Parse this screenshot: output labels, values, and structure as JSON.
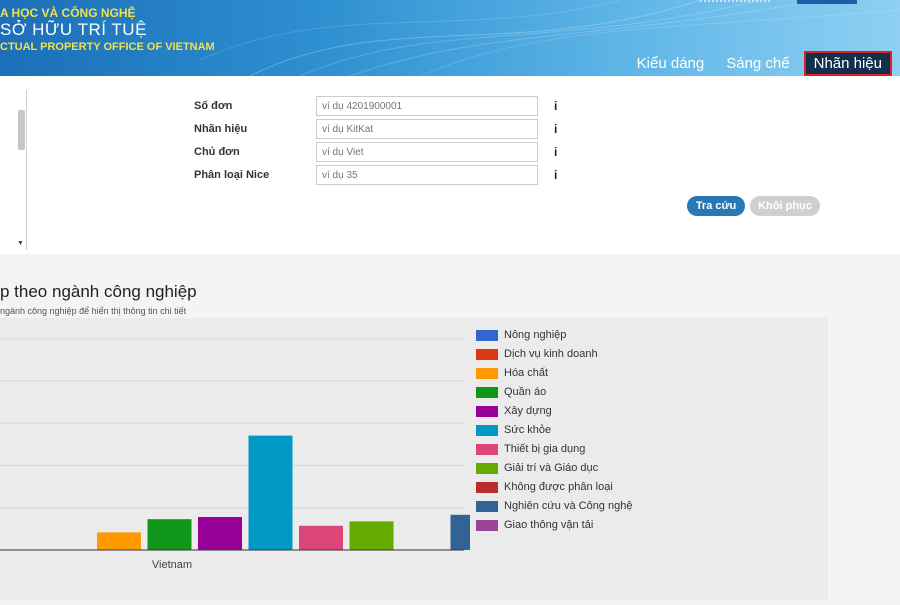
{
  "header": {
    "brand_line1": "A HỌC VÀ CÔNG NGHỆ",
    "brand_line2": "SỞ HỮU TRÍ TUỆ",
    "brand_line3": "CTUAL PROPERTY OFFICE OF VIETNAM",
    "nav": [
      {
        "label": "Kiểu dáng"
      },
      {
        "label": "Sáng chế"
      },
      {
        "label": "Nhãn hiệu",
        "active": true
      }
    ]
  },
  "search_form": {
    "fields": [
      {
        "label": "Số đơn",
        "placeholder": "ví dụ 4201900001"
      },
      {
        "label": "Nhãn hiệu",
        "placeholder": "ví dụ KitKat"
      },
      {
        "label": "Chủ đơn",
        "placeholder": "ví dụ Viet"
      },
      {
        "label": "Phân loại Nice",
        "placeholder": "ví dụ 35"
      }
    ],
    "info_icon": "i",
    "search_button": "Tra cứu",
    "reset_button": "Khôi phục"
  },
  "section": {
    "title": "p theo ngành công nghiệp",
    "subtitle": "ngành công nghiệp để hiển thị thông tin chi tiết"
  },
  "chart_data": {
    "type": "bar",
    "categories": [
      "Vietnam"
    ],
    "ylim": [
      0,
      100
    ],
    "grid": true,
    "legend_position": "right",
    "series": [
      {
        "name": "Nông nghiệp",
        "color": "#3366cc",
        "values": [
          0
        ]
      },
      {
        "name": "Dịch vụ kinh doanh",
        "color": "#dc3912",
        "values": [
          0
        ]
      },
      {
        "name": "Hóa chất",
        "color": "#ff9900",
        "values": [
          8
        ]
      },
      {
        "name": "Quần áo",
        "color": "#109618",
        "values": [
          14
        ]
      },
      {
        "name": "Xây dựng",
        "color": "#990099",
        "values": [
          15
        ]
      },
      {
        "name": "Sức khỏe",
        "color": "#0099c6",
        "values": [
          52
        ]
      },
      {
        "name": "Thiết bị gia dụng",
        "color": "#dd4477",
        "values": [
          11
        ]
      },
      {
        "name": "Giải trí và Giáo dục",
        "color": "#66aa00",
        "values": [
          13
        ]
      },
      {
        "name": "Không được phân loại",
        "color": "#b82e2e",
        "values": [
          0
        ]
      },
      {
        "name": "Nghiên cứu và Công nghệ",
        "color": "#316395",
        "values": [
          16
        ]
      },
      {
        "name": "Giao thông vận tải",
        "color": "#994499",
        "values": [
          12
        ]
      }
    ]
  }
}
